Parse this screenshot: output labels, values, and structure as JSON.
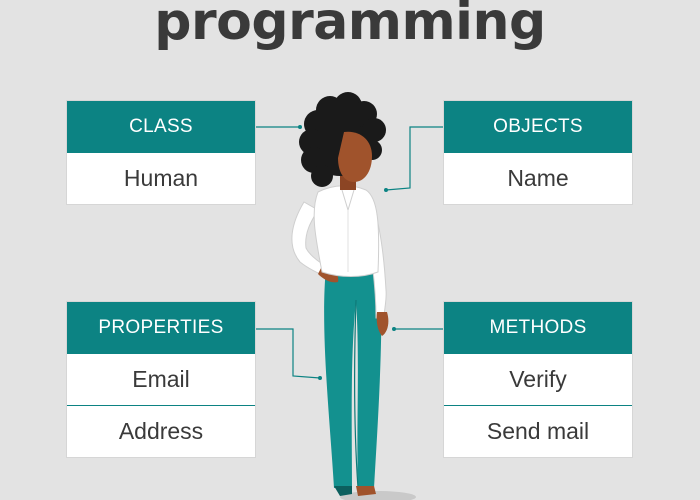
{
  "title": "programming",
  "cards": {
    "class": {
      "header": "CLASS",
      "rows": [
        "Human"
      ]
    },
    "objects": {
      "header": "OBJECTS",
      "rows": [
        "Name"
      ]
    },
    "properties": {
      "header": "PROPERTIES",
      "rows": [
        "Email",
        "Address"
      ]
    },
    "methods": {
      "header": "METHODS",
      "rows": [
        "Verify",
        "Send mail"
      ]
    }
  },
  "colors": {
    "background": "#e3e3e3",
    "header_teal": "#0c8383",
    "title_text": "#3a3a3a",
    "pants_teal": "#13918f",
    "shirt": "#ffffff",
    "skin": "#a0532c",
    "hair": "#1a1a1a"
  },
  "illustration": "woman-figure"
}
